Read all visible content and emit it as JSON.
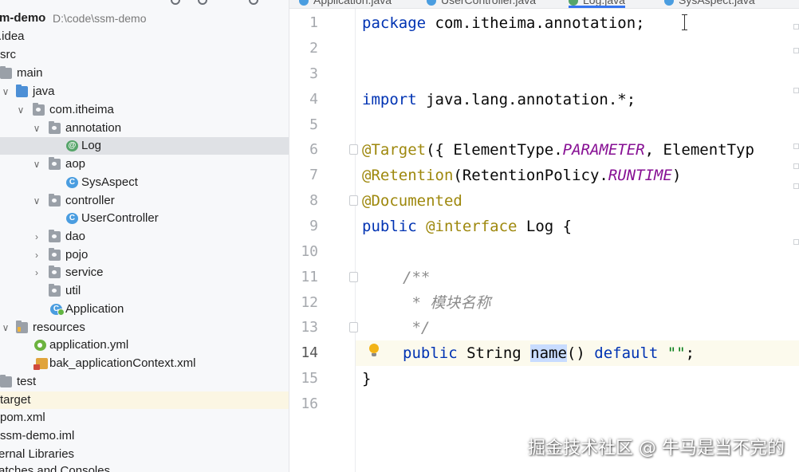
{
  "tabs": [
    {
      "label": "Application.java",
      "icon": "class"
    },
    {
      "label": "UserController.java",
      "icon": "class"
    },
    {
      "label": "Log.java",
      "icon": "annotation",
      "active": true
    },
    {
      "label": "SysAspect.java",
      "icon": "class"
    }
  ],
  "project": {
    "root_label": "m-demo",
    "root_path": "D:\\code\\ssm-demo",
    "items": [
      {
        "label": ".idea",
        "icon": "folder"
      },
      {
        "label": "src",
        "icon": "folder"
      },
      {
        "label": "main",
        "icon": "folder"
      },
      {
        "label": "java",
        "icon": "folder-blue"
      },
      {
        "label": "com.itheima",
        "icon": "package"
      },
      {
        "label": "annotation",
        "icon": "package"
      },
      {
        "label": "Log",
        "icon": "annotation"
      },
      {
        "label": "aop",
        "icon": "package"
      },
      {
        "label": "SysAspect",
        "icon": "class"
      },
      {
        "label": "controller",
        "icon": "package"
      },
      {
        "label": "UserController",
        "icon": "class"
      },
      {
        "label": "dao",
        "icon": "package"
      },
      {
        "label": "pojo",
        "icon": "package"
      },
      {
        "label": "service",
        "icon": "package"
      },
      {
        "label": "util",
        "icon": "package"
      },
      {
        "label": "Application",
        "icon": "spring-class"
      },
      {
        "label": "resources",
        "icon": "resources-folder"
      },
      {
        "label": "application.yml",
        "icon": "yaml"
      },
      {
        "label": "bak_applicationContext.xml",
        "icon": "xml"
      },
      {
        "label": "test",
        "icon": "folder"
      },
      {
        "label": "target",
        "icon": "folder"
      },
      {
        "label": "pom.xml",
        "icon": "maven"
      },
      {
        "label": "ssm-demo.iml",
        "icon": "module"
      },
      {
        "label": "ernal Libraries",
        "icon": "library"
      },
      {
        "label": "atches and Consoles",
        "icon": "scratches"
      }
    ],
    "selected": "Log",
    "highlighted": "target"
  },
  "editor": {
    "current_line": "14",
    "line_numbers": [
      "1",
      "2",
      "3",
      "4",
      "5",
      "6",
      "7",
      "8",
      "9",
      "10",
      "11",
      "12",
      "13",
      "14",
      "15",
      "16"
    ],
    "code": {
      "l1_kw": "package",
      "l1_rest": " com.itheima.annotation;",
      "l4_kw": "import",
      "l4_rest": " java.lang.annotation.*;",
      "l6_an": "@Target",
      "l6_a": "({ ElementType.",
      "l6_it": "PARAMETER",
      "l6_b": ", ElementTyp",
      "l7_an": "@Retention",
      "l7_a": "(RetentionPolicy.",
      "l7_it": "RUNTIME",
      "l7_b": ")",
      "l8_an": "@Documented",
      "l9_kw": "public",
      "l9_sp": " ",
      "l9_an": "@interface",
      "l9_rest": " Log {",
      "l11_cm": "/**",
      "l12_cm": " * 模块名称",
      "l13_cm": " */",
      "l14_kw": "public",
      "l14_a": " String ",
      "l14_hl": "name",
      "l14_b": "() ",
      "l14_kw2": "default",
      "l14_sp": " ",
      "l14_st": "\"\"",
      "l14_c": ";",
      "l15": "}"
    }
  },
  "watermark": "掘金技术社区 @ 牛马是当不完的",
  "colors": {
    "keyword": "#0033b3",
    "annotation": "#9e880d",
    "enum_const": "#871094",
    "comment": "#8c8c8c",
    "string": "#067d17",
    "selection": "#c8dcff",
    "active_tab_underline": "#3574f0"
  }
}
